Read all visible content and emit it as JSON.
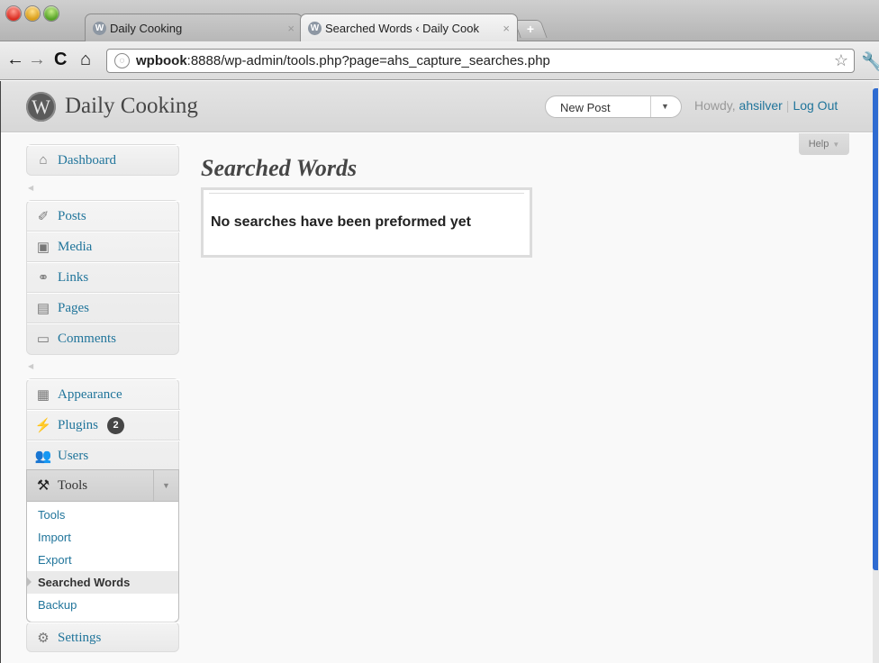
{
  "browser": {
    "tabs": [
      {
        "title": "Daily Cooking",
        "active": false
      },
      {
        "title": "Searched Words ‹ Daily Cook",
        "active": true
      }
    ],
    "url_host": "wpbook",
    "url_rest": ":8888/wp-admin/tools.php?page=ahs_capture_searches.php"
  },
  "header": {
    "site_title": "Daily Cooking",
    "favorites_label": "New Post",
    "howdy": "Howdy,",
    "username": "ahsilver",
    "separator": "|",
    "logout": "Log Out",
    "help": "Help"
  },
  "menu": {
    "dashboard": "Dashboard",
    "posts": "Posts",
    "media": "Media",
    "links": "Links",
    "pages": "Pages",
    "comments": "Comments",
    "appearance": "Appearance",
    "plugins": "Plugins",
    "plugins_badge": "2",
    "users": "Users",
    "tools": "Tools",
    "settings": "Settings",
    "tools_submenu": [
      "Tools",
      "Import",
      "Export",
      "Searched Words",
      "Backup"
    ]
  },
  "content": {
    "heading": "Searched Words",
    "notice": "No searches have been preformed yet"
  },
  "colors": {
    "link": "#21759b",
    "text": "#464646",
    "badge": "#464646"
  }
}
